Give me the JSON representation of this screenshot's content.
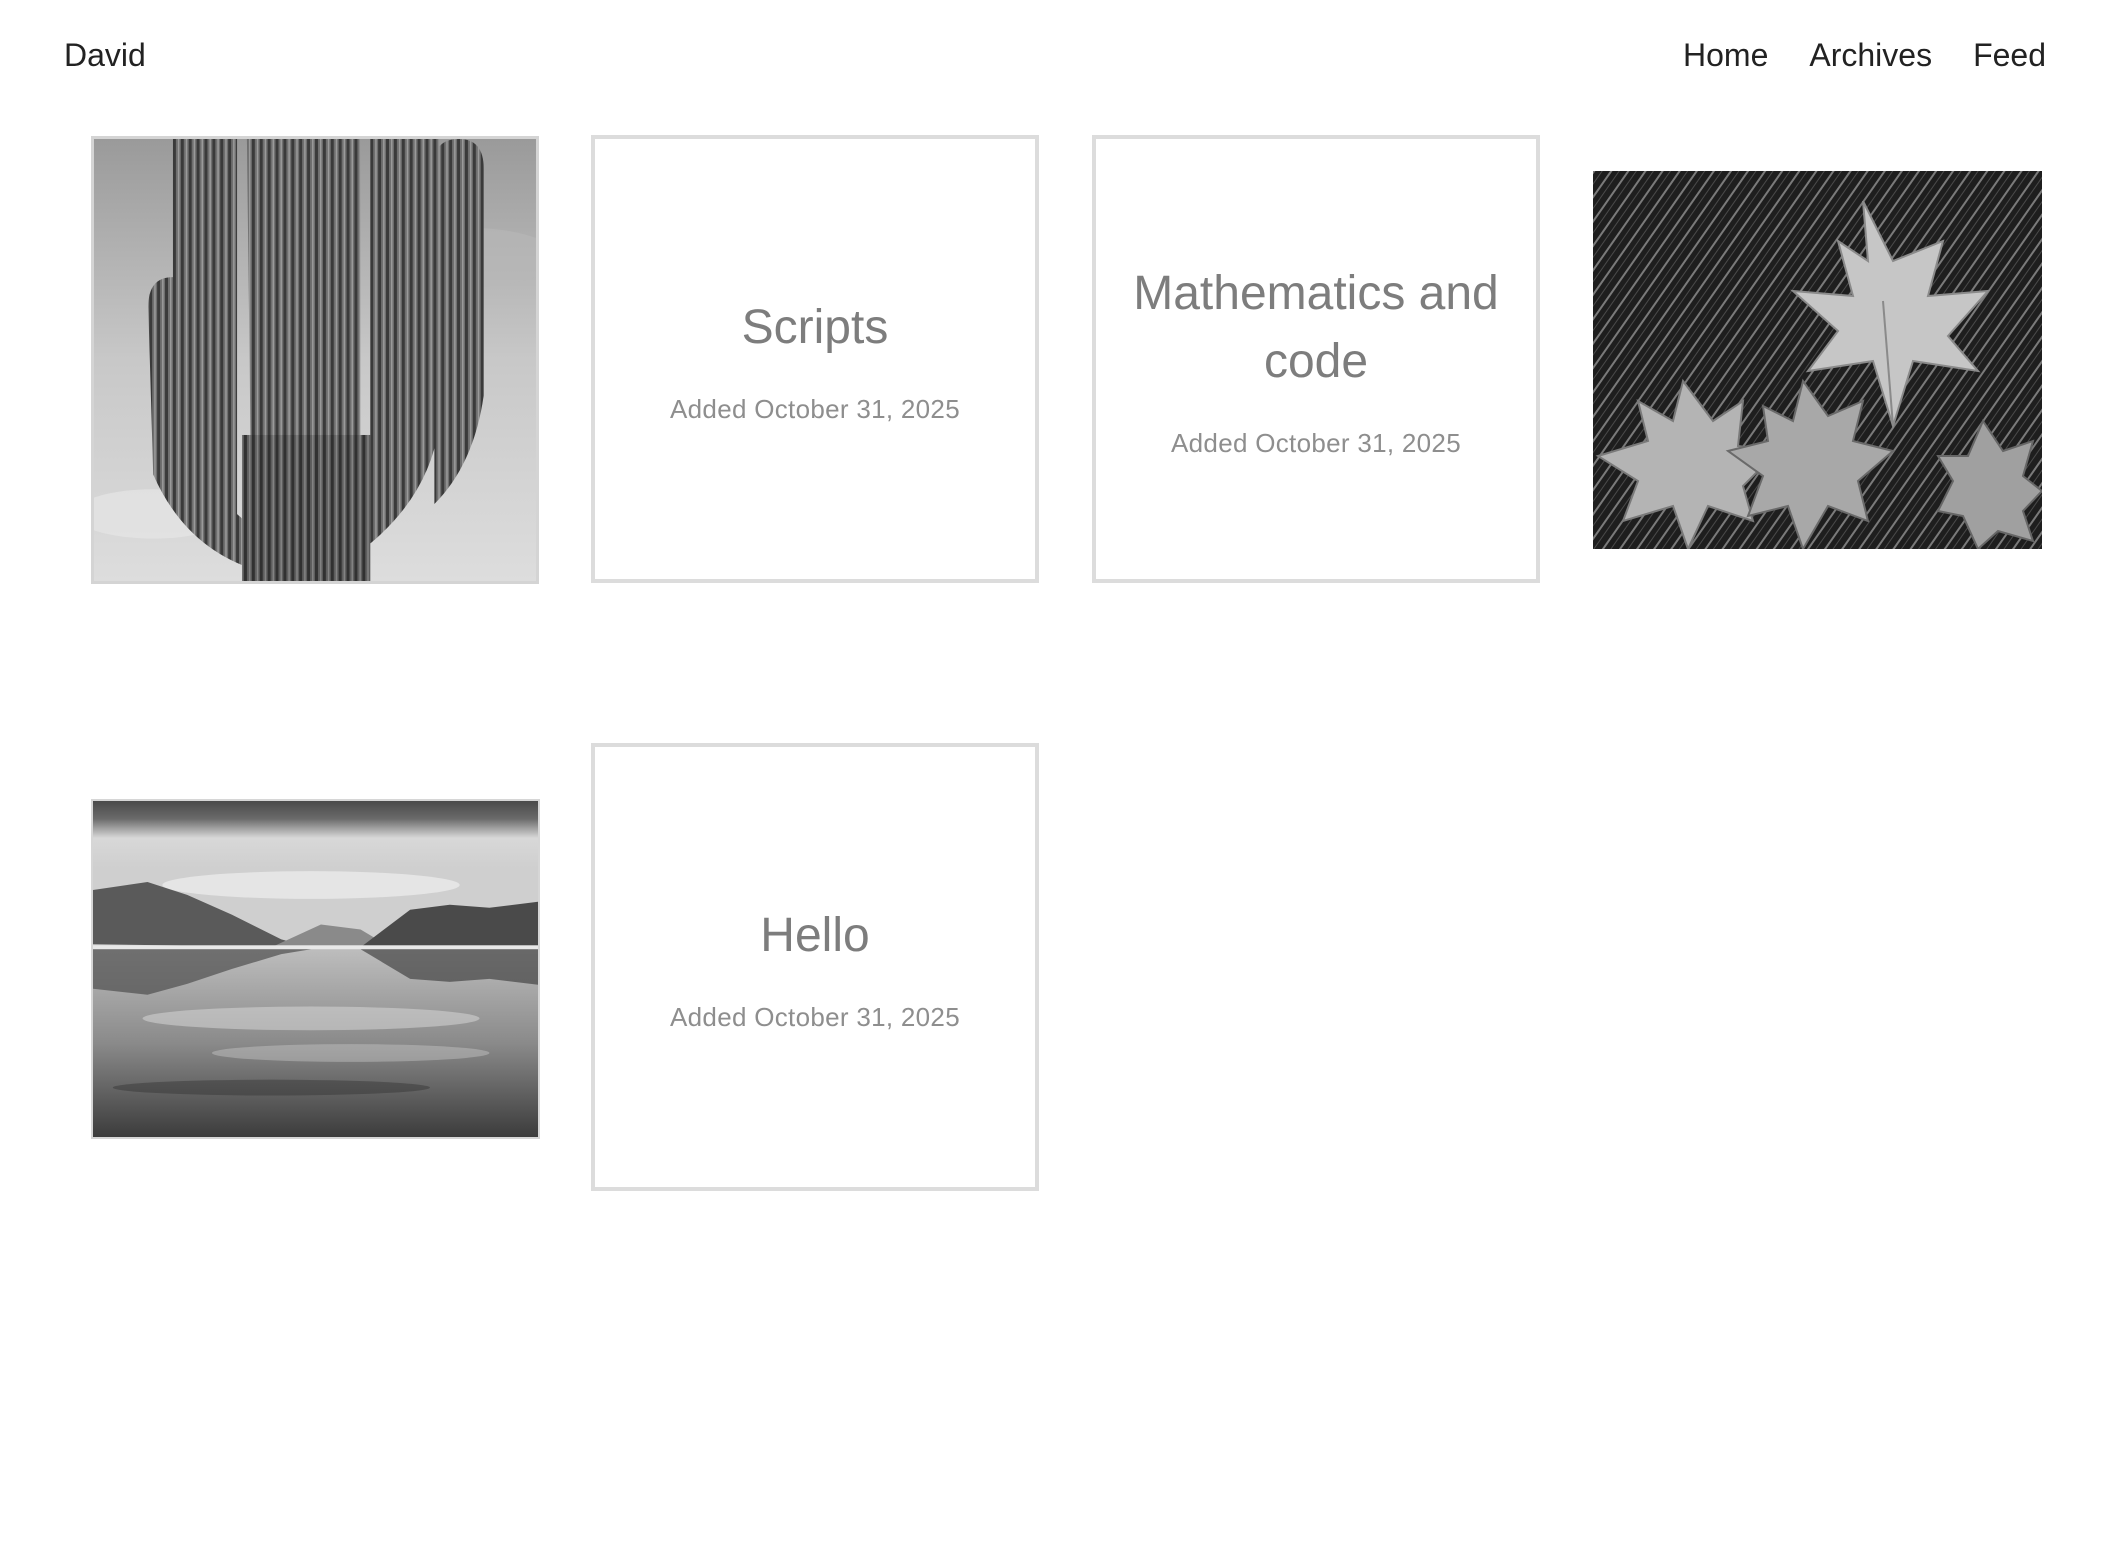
{
  "header": {
    "site_title": "David",
    "nav": [
      {
        "label": "Home"
      },
      {
        "label": "Archives"
      },
      {
        "label": "Feed"
      }
    ]
  },
  "grid": {
    "posts": [
      {
        "kind": "photo",
        "subject": "saguaro-cactus"
      },
      {
        "kind": "text",
        "title": "Scripts",
        "date": "Added October 31, 2025"
      },
      {
        "kind": "text",
        "title": "Mathematics and code",
        "date": "Added October 31, 2025"
      },
      {
        "kind": "photo",
        "subject": "leaves-and-ferns"
      },
      {
        "kind": "photo",
        "subject": "lake-and-mountains"
      },
      {
        "kind": "text",
        "title": "Hello",
        "date": "Added October 31, 2025"
      }
    ]
  },
  "colors": {
    "card_border": "#dcdcdc",
    "card_title": "#7d7d7d",
    "card_date": "#8e8e8e",
    "text": "#222222"
  }
}
